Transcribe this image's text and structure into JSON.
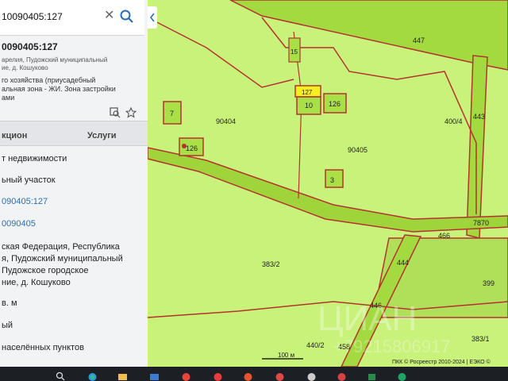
{
  "search": {
    "value": "10090405:127"
  },
  "object": {
    "title": "0090405:127",
    "address_lines": [
      "арелия, Пудожский муниципальный",
      "ие, д. Кошуково"
    ],
    "use_lines": [
      "го хозяйства (приусадебный",
      "альная зона - ЖИ. Зона застройки",
      "ами"
    ]
  },
  "tabs": {
    "info": "кцион",
    "services": "Услуги"
  },
  "fields": {
    "type": "т недвижимости",
    "kind": "ьный участок",
    "cad_number": "090405:127",
    "block": "0090405",
    "address": [
      "ская Федерация, Республика",
      "я, Пудожский муниципальный",
      "Пудожское городское",
      "ние, д. Кошуково"
    ],
    "area_unit": "в. м",
    "status": "ый",
    "category": "населённых пунктов"
  },
  "map": {
    "labels": {
      "p447": "447",
      "p15": "15",
      "p127": "127",
      "p10": "10",
      "p126a": "126",
      "p7": "7",
      "q90404": "90404",
      "q90405": "90405",
      "p126b": "126",
      "p3": "3",
      "p400_4": "400/4",
      "p443": "443",
      "p7870": "7870",
      "p466": "466",
      "p444": "444",
      "p383_2": "383/2",
      "p399": "399",
      "p446": "446",
      "p458": "458",
      "p440_2": "440/2",
      "p383_1": "383/1"
    },
    "scale": "100 м",
    "copyright": "ПКК © Росреестр 2010-2024 | ЕЭКО ©",
    "watermark": "ЦИАН",
    "watermark_sub": "+79215806917",
    "colors": {
      "land": "#c8f27a",
      "parcel": "#a9e048",
      "border": "#b5332f",
      "selected": "#f7f020"
    }
  },
  "taskbar": {
    "icons": [
      "search-icon",
      "edge-icon",
      "files-icon",
      "store-icon",
      "yandex-icon",
      "opera-icon",
      "recorder-icon",
      "app-icon",
      "settings-icon",
      "app2-icon",
      "app3-icon",
      "app4-icon"
    ]
  }
}
